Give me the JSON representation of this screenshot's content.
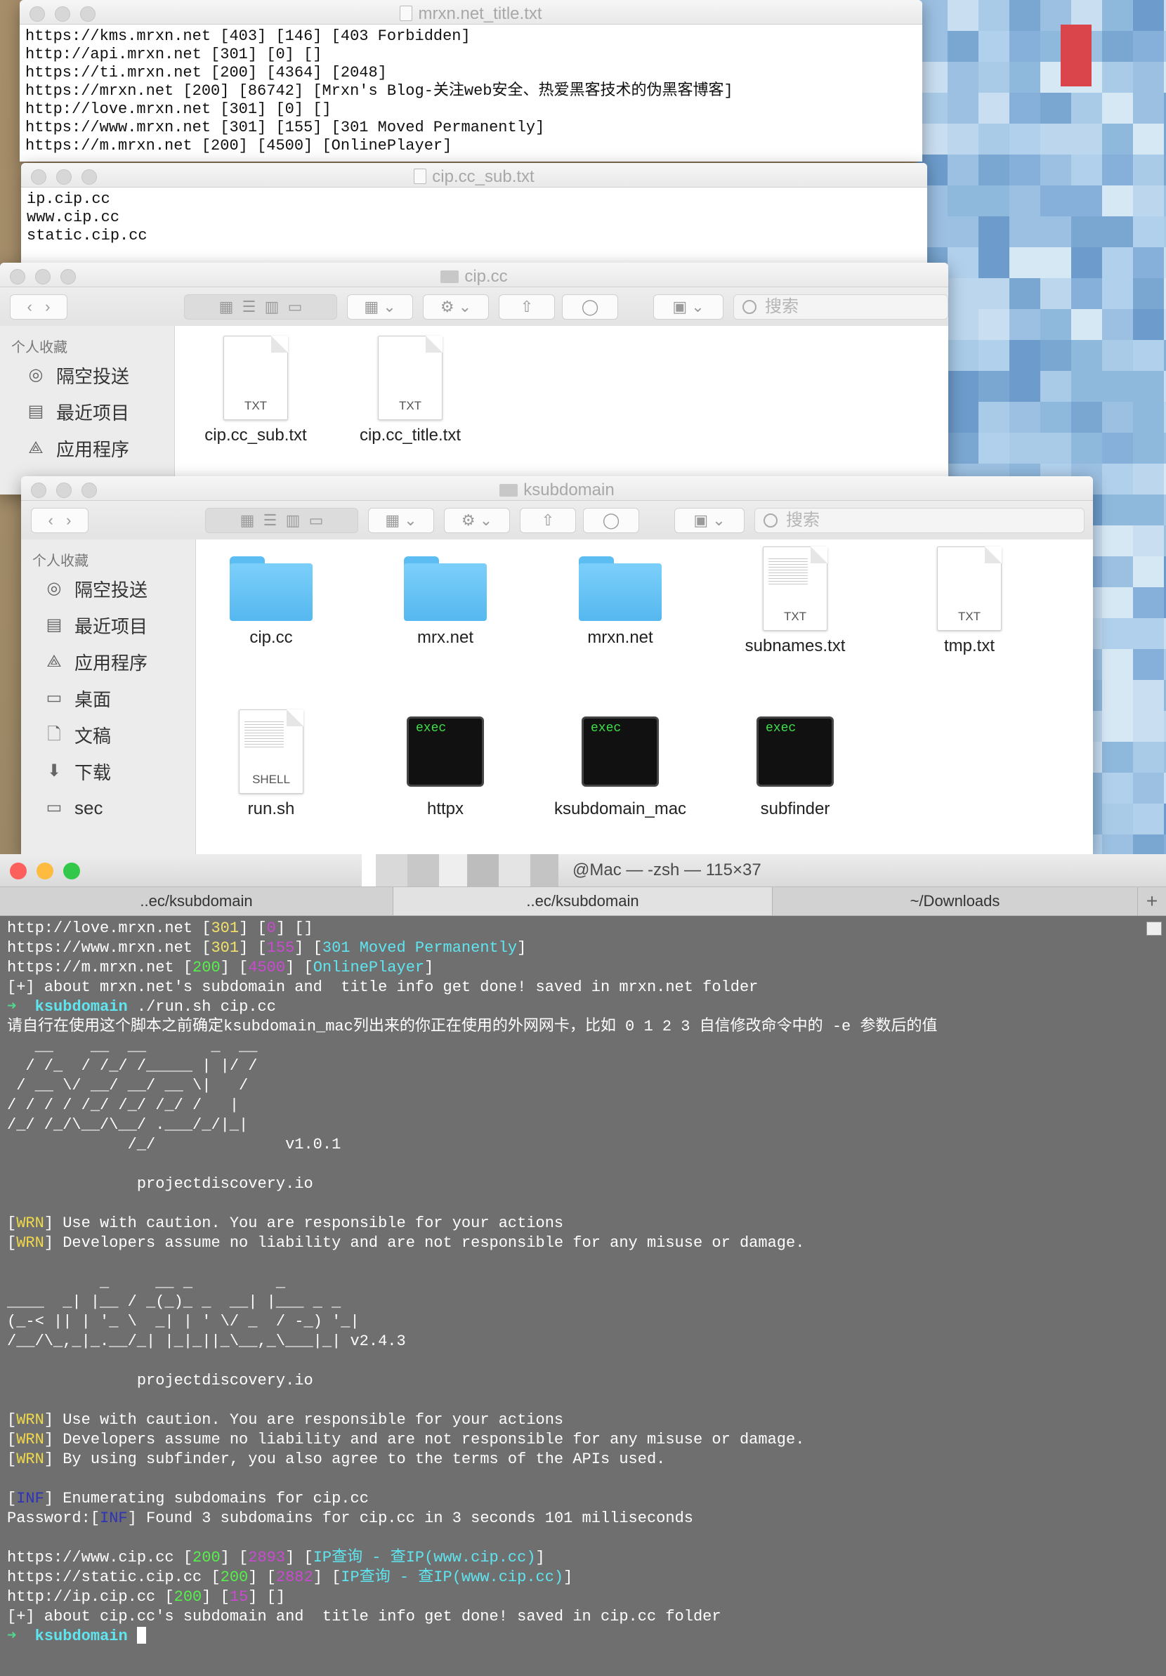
{
  "window1": {
    "title": "mrxn.net_title.txt",
    "lines": [
      "https://kms.mrxn.net [403] [146] [403 Forbidden]",
      "http://api.mrxn.net [301] [0] []",
      "https://ti.mrxn.net [200] [4364] [2048]",
      "https://mrxn.net [200] [86742] [Mrxn's Blog-关注web安全、热爱黑客技术的伪黑客博客]",
      "http://love.mrxn.net [301] [0] []",
      "https://www.mrxn.net [301] [155] [301 Moved Permanently]",
      "https://m.mrxn.net [200] [4500] [OnlinePlayer]"
    ]
  },
  "window2": {
    "title": "cip.cc_sub.txt",
    "lines": [
      "ip.cip.cc",
      "www.cip.cc",
      "static.cip.cc"
    ]
  },
  "finder1": {
    "title": "cip.cc",
    "search_placeholder": "搜索",
    "sidebar_heading": "个人收藏",
    "sidebar": [
      "隔空投送",
      "最近项目",
      "应用程序"
    ],
    "files": [
      {
        "name": "cip.cc_sub.txt",
        "ext": "TXT"
      },
      {
        "name": "cip.cc_title.txt",
        "ext": "TXT"
      }
    ]
  },
  "finder2": {
    "title": "ksubdomain",
    "search_placeholder": "搜索",
    "sidebar_heading": "个人收藏",
    "sidebar": [
      "隔空投送",
      "最近项目",
      "应用程序",
      "桌面",
      "文稿",
      "下载",
      "sec"
    ],
    "items": [
      {
        "name": "cip.cc",
        "kind": "folder"
      },
      {
        "name": "mrx.net",
        "kind": "folder"
      },
      {
        "name": "mrxn.net",
        "kind": "folder"
      },
      {
        "name": "subnames.txt",
        "kind": "file",
        "ext": "TXT"
      },
      {
        "name": "tmp.txt",
        "kind": "file",
        "ext": "TXT"
      },
      {
        "name": "run.sh",
        "kind": "file",
        "ext": "SHELL"
      },
      {
        "name": "httpx",
        "kind": "exec",
        "ext": "exec"
      },
      {
        "name": "ksubdomain_mac",
        "kind": "exec",
        "ext": "exec"
      },
      {
        "name": "subfinder",
        "kind": "exec",
        "ext": "exec"
      }
    ]
  },
  "terminal": {
    "title": "@Mac — -zsh — 115×37",
    "tabs": [
      "..ec/ksubdomain",
      "..ec/ksubdomain",
      "~/Downloads"
    ],
    "new_tab": "+",
    "prompt_symbol": "➜",
    "prompt_dir": "ksubdomain",
    "run_cmd": "./run.sh cip.cc",
    "l_love": [
      "http://love.mrxn.net ",
      "301",
      "0"
    ],
    "l_www": [
      "https://www.mrxn.net ",
      "301",
      "155",
      "301 Moved Permanently"
    ],
    "l_m": [
      "https://m.mrxn.net ",
      "200",
      "4500",
      "OnlinePlayer"
    ],
    "done1": "[+] about mrxn.net's subdomain and  title info get done! saved in mrxn.net folder",
    "zh_warning": "请自行在使用这个脚本之前确定ksubdomain_mac列出来的你正在使用的外网网卡，比如 0 1 2 3 自信修改命令中的 -e 参数后的值",
    "banner1": "   __    __  __       _  __\n  / /_  / /_/ /_____ | |/ /\n / __ \\/ __/ __/ __ \\|   / \n/ / / / /_/ /_/ /_/ /   |  \n/_/ /_/\\__/\\__/ .___/_/|_|  \n             /_/              v1.0.1",
    "projectdiscovery": "projectdiscovery.io",
    "wrn_tag": "WRN",
    "inf_tag": "INF",
    "wrn1": "Use with caution. You are responsible for your actions",
    "wrn2": "Developers assume no liability and are not responsible for any misuse or damage.",
    "banner2": "          _     __ _         _\n____  _| |__ / _(_)_ _  __| |___ _ _\n(_-< || | '_ \\  _| | ' \\/ _  / -_) '_|\n/__/\\_,_|_.__/_| |_|_||_\\__,_\\___|_| v2.4.3",
    "wrn3": "By using subfinder, you also agree to the terms of the APIs used.",
    "inf1": "Enumerating subdomains for cip.cc",
    "password_prefix": "Password:",
    "inf2": "Found 3 subdomains for cip.cc in 3 seconds 101 milliseconds",
    "r_www": [
      "https://www.cip.cc ",
      "200",
      "2893",
      "IP查询 - 查IP(www.cip.cc)"
    ],
    "r_static": [
      "https://static.cip.cc ",
      "200",
      "2882",
      "IP查询 - 查IP(www.cip.cc)"
    ],
    "r_ip": [
      "http://ip.cip.cc ",
      "200",
      "15"
    ],
    "done2": "[+] about cip.cc's subdomain and  title info get done! saved in cip.cc folder"
  },
  "colors": {
    "accent_yellow": "#f2e26b",
    "accent_magenta": "#c94ad0",
    "accent_cyan": "#5fe5ef",
    "close": "#fc605c",
    "minimize": "#fdbc40",
    "zoom": "#34c84a"
  }
}
